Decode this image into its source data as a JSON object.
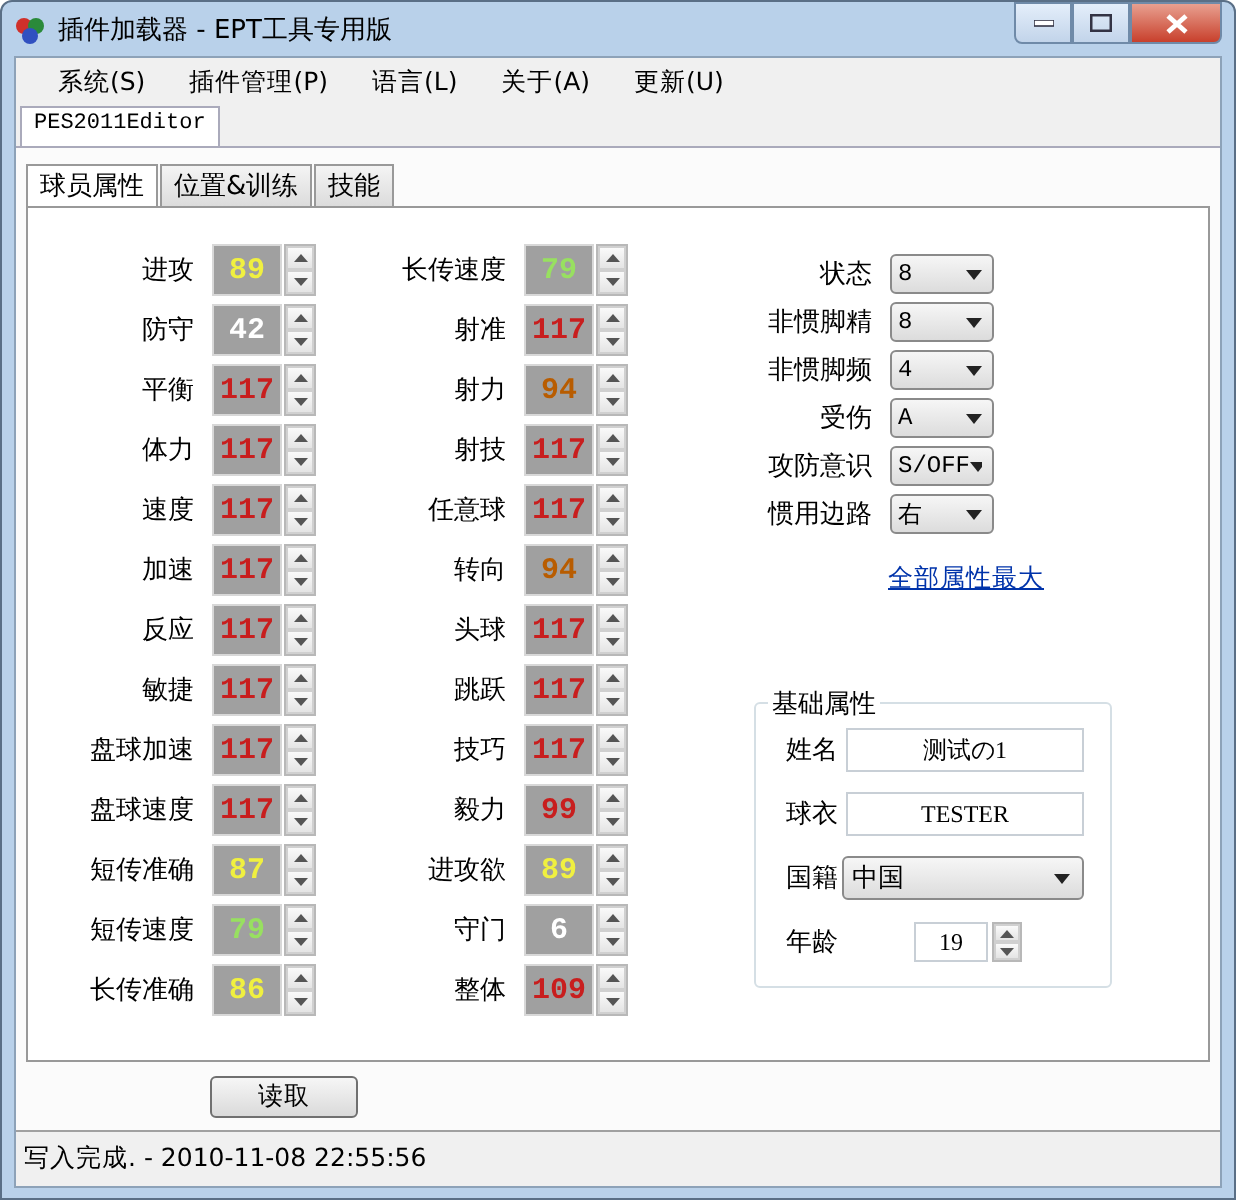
{
  "window": {
    "title": "插件加载器 - EPT工具专用版"
  },
  "menu": [
    "系统(S)",
    "插件管理(P)",
    "语言(L)",
    "关于(A)",
    "更新(U)"
  ],
  "doc_tabs": [
    {
      "label": "PES2011Editor",
      "selected": true
    }
  ],
  "tabs": [
    {
      "label": "球员属性",
      "selected": true
    },
    {
      "label": "位置&训练",
      "selected": false
    },
    {
      "label": "技能",
      "selected": false
    }
  ],
  "stats_left": [
    {
      "label": "进攻",
      "value": "89",
      "color": "#f0f040"
    },
    {
      "label": "防守",
      "value": "42",
      "color": "#ffffff"
    },
    {
      "label": "平衡",
      "value": "117",
      "color": "#c81e1e"
    },
    {
      "label": "体力",
      "value": "117",
      "color": "#c81e1e"
    },
    {
      "label": "速度",
      "value": "117",
      "color": "#c81e1e"
    },
    {
      "label": "加速",
      "value": "117",
      "color": "#c81e1e"
    },
    {
      "label": "反应",
      "value": "117",
      "color": "#c81e1e"
    },
    {
      "label": "敏捷",
      "value": "117",
      "color": "#c81e1e"
    },
    {
      "label": "盘球加速",
      "value": "117",
      "color": "#c81e1e"
    },
    {
      "label": "盘球速度",
      "value": "117",
      "color": "#c81e1e"
    },
    {
      "label": "短传准确",
      "value": "87",
      "color": "#f0f040"
    },
    {
      "label": "短传速度",
      "value": "79",
      "color": "#98e060"
    },
    {
      "label": "长传准确",
      "value": "86",
      "color": "#f0f040"
    }
  ],
  "stats_right": [
    {
      "label": "长传速度",
      "value": "79",
      "color": "#98e060"
    },
    {
      "label": "射准",
      "value": "117",
      "color": "#c81e1e"
    },
    {
      "label": "射力",
      "value": "94",
      "color": "#b85c00"
    },
    {
      "label": "射技",
      "value": "117",
      "color": "#c81e1e"
    },
    {
      "label": "任意球",
      "value": "117",
      "color": "#c81e1e"
    },
    {
      "label": "转向",
      "value": "94",
      "color": "#b85c00"
    },
    {
      "label": "头球",
      "value": "117",
      "color": "#c81e1e"
    },
    {
      "label": "跳跃",
      "value": "117",
      "color": "#c81e1e"
    },
    {
      "label": "技巧",
      "value": "117",
      "color": "#c81e1e"
    },
    {
      "label": "毅力",
      "value": "99",
      "color": "#c81e1e"
    },
    {
      "label": "进攻欲",
      "value": "89",
      "color": "#f0f040"
    },
    {
      "label": "守门",
      "value": "6",
      "color": "#ffffff"
    },
    {
      "label": "整体",
      "value": "109",
      "color": "#c81e1e"
    }
  ],
  "options": [
    {
      "label": "状态",
      "value": "8"
    },
    {
      "label": "非惯脚精",
      "value": "8"
    },
    {
      "label": "非惯脚频",
      "value": "4"
    },
    {
      "label": "受伤",
      "value": "A"
    },
    {
      "label": "攻防意识",
      "value": "S/OFF"
    },
    {
      "label": "惯用边路",
      "value": "右"
    }
  ],
  "max_all_link": "全部属性最大",
  "basic": {
    "title": "基础属性",
    "name_label": "姓名",
    "name": "测试の1",
    "shirt_label": "球衣",
    "shirt": "TESTER",
    "nation_label": "国籍",
    "nation": "中国",
    "age_label": "年龄",
    "age": "19"
  },
  "read_button": "读取",
  "status_bar": "写入完成. - 2010-11-08 22:55:56"
}
